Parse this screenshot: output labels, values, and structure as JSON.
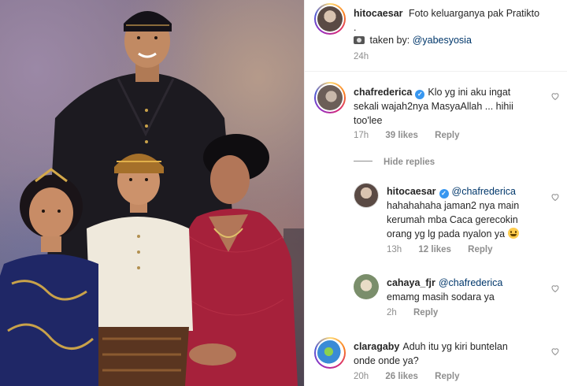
{
  "post": {
    "author": "hitocaesar",
    "caption_line1": "Foto keluarganya pak Pratikto",
    "caption_line2": ".",
    "camera_icon": "camera-emoji-icon",
    "taken_by_label": "taken by: ",
    "taken_by_mention": "@yabesyosia",
    "time": "24h"
  },
  "comments": [
    {
      "username": "chafrederica",
      "verified": true,
      "text_line1": "Klo yg ini aku ingat",
      "text_line2": "sekali wajah2nya MasyaAllah ... hihii",
      "text_line3": "too'lee",
      "time": "17h",
      "likes": "39 likes",
      "reply": "Reply"
    },
    {
      "toggle_label": "Hide replies",
      "is_reply": true,
      "username": "hitocaesar",
      "verified": true,
      "mention": "@chafrederica",
      "text_line1": "hahahahaha jaman2 nya main",
      "text_line2": "kerumah mba Caca gerecokin",
      "text_line3": "orang yg lg pada nyalon ya",
      "time": "13h",
      "likes": "12 likes",
      "reply": "Reply"
    },
    {
      "is_reply": true,
      "username": "cahaya_fjr",
      "mention": "@chafrederica",
      "text_line1": "emamg masih sodara ya",
      "time": "2h",
      "reply": "Reply"
    },
    {
      "username": "claragaby",
      "text_line1": "Aduh itu yg kiri buntelan",
      "text_line2": "onde onde ya?",
      "time": "20h",
      "likes": "26 likes",
      "reply": "Reply"
    }
  ],
  "colors": {
    "mention": "#00376b",
    "meta": "#8e8e8e",
    "verified": "#3897f0"
  }
}
